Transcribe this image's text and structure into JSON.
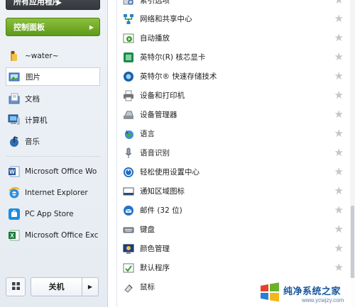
{
  "left_pane": {
    "all_apps_label": "所有应用程序",
    "control_panel_label": "控制面板",
    "user_name": "~water~",
    "places": [
      {
        "label": "图片",
        "icon": "pictures-icon"
      },
      {
        "label": "文档",
        "icon": "documents-icon"
      },
      {
        "label": "计算机",
        "icon": "computer-icon"
      },
      {
        "label": "音乐",
        "icon": "music-icon"
      }
    ],
    "pinned": [
      {
        "label": "Microsoft Office Wo",
        "icon": "word-icon"
      },
      {
        "label": "Internet Explorer",
        "icon": "ie-icon"
      },
      {
        "label": "PC App Store",
        "icon": "app-store-icon"
      },
      {
        "label": "Microsoft Office Exc",
        "icon": "excel-icon"
      }
    ],
    "shutdown_label": "关机"
  },
  "control_panel_items": [
    {
      "label": "索引选项",
      "icon": "indexing-icon"
    },
    {
      "label": "网络和共享中心",
      "icon": "network-icon"
    },
    {
      "label": "自动播放",
      "icon": "autoplay-icon"
    },
    {
      "label": "英特尔(R) 核芯显卡",
      "icon": "intel-graphics-icon"
    },
    {
      "label": "英特尔® 快速存储技术",
      "icon": "intel-storage-icon"
    },
    {
      "label": "设备和打印机",
      "icon": "printer-icon"
    },
    {
      "label": "设备管理器",
      "icon": "device-manager-icon"
    },
    {
      "label": "语言",
      "icon": "language-icon"
    },
    {
      "label": "语音识别",
      "icon": "microphone-icon"
    },
    {
      "label": "轻松使用设置中心",
      "icon": "ease-of-access-icon"
    },
    {
      "label": "通知区域图标",
      "icon": "notification-icon"
    },
    {
      "label": "邮件 (32 位)",
      "icon": "mail-icon"
    },
    {
      "label": "键盘",
      "icon": "keyboard-icon"
    },
    {
      "label": "颜色管理",
      "icon": "color-management-icon"
    },
    {
      "label": "默认程序",
      "icon": "default-programs-icon"
    },
    {
      "label": "鼠标",
      "icon": "mouse-icon"
    }
  ],
  "watermark": {
    "title": "纯净系统之家",
    "url": "www.ycwjzy.com"
  },
  "colors": {
    "control_panel_green": "#6aa823",
    "all_apps_dark": "#3d4045",
    "star_gray": "#c4c6ca",
    "watermark_blue": "#16569e"
  }
}
